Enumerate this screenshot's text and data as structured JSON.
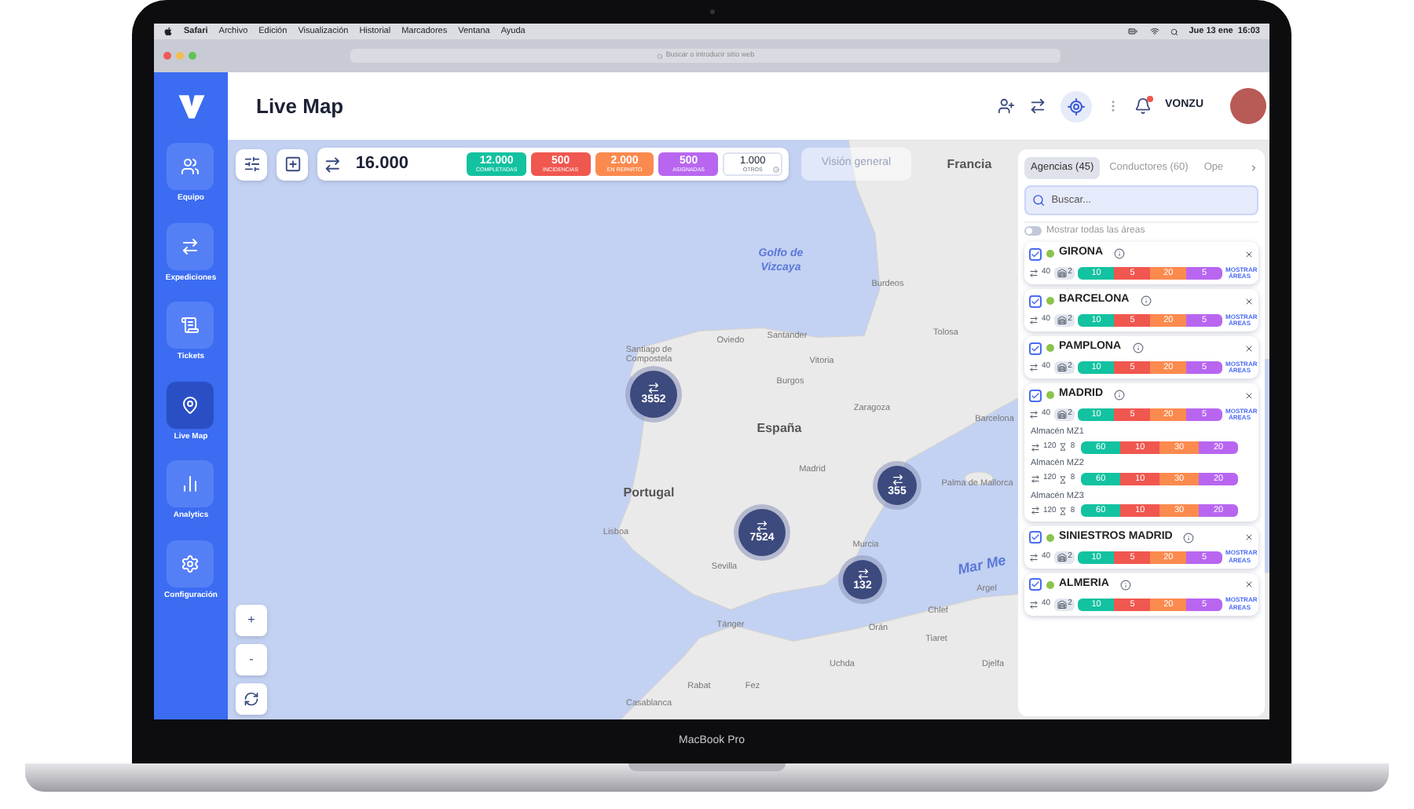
{
  "device_label": "MacBook Pro",
  "menubar": {
    "app": "Safari",
    "items": [
      "Archivo",
      "Edición",
      "Visualización",
      "Historial",
      "Marcadores",
      "Ventana",
      "Ayuda"
    ],
    "clock": "Jue 13 ene  16:03"
  },
  "browser": {
    "address_placeholder": "Buscar o introducir sitio web"
  },
  "sidebar": {
    "items": [
      {
        "label": "Equipo",
        "selected": false
      },
      {
        "label": "Expediciones",
        "selected": false
      },
      {
        "label": "Tickets",
        "selected": false
      },
      {
        "label": "Live Map",
        "selected": true
      },
      {
        "label": "Analytics",
        "selected": false
      },
      {
        "label": "Configuración",
        "selected": false
      }
    ]
  },
  "header": {
    "title": "Live Map",
    "user": "VONZU"
  },
  "toolbar": {
    "total": "16.000",
    "stats": [
      {
        "value": "12.000",
        "label": "COMPLETADAS",
        "color": "#13c2a0"
      },
      {
        "value": "500",
        "label": "INCIDENCIAS",
        "color": "#f0574f"
      },
      {
        "value": "2.000",
        "label": "EN REPARTO",
        "color": "#fb8a4e"
      },
      {
        "value": "500",
        "label": "ASIGNADAS",
        "color": "#b866f0"
      }
    ],
    "others": {
      "value": "1.000",
      "label": "OTROS"
    },
    "overview_button": "Visión general"
  },
  "map": {
    "labels": [
      {
        "text": "Francia",
        "kind": "country"
      },
      {
        "text": "Golfo de Vizcaya",
        "kind": "sea"
      },
      {
        "text": "Burdeos",
        "kind": "city"
      },
      {
        "text": "Tolosa",
        "kind": "city"
      },
      {
        "text": "Santiago de Compostela",
        "kind": "city"
      },
      {
        "text": "Oviedo",
        "kind": "city"
      },
      {
        "text": "Santander",
        "kind": "city"
      },
      {
        "text": "Vitoria",
        "kind": "city"
      },
      {
        "text": "Burgos",
        "kind": "city"
      },
      {
        "text": "Zaragoza",
        "kind": "city"
      },
      {
        "text": "Barcelona",
        "kind": "city"
      },
      {
        "text": "España",
        "kind": "country"
      },
      {
        "text": "Madrid",
        "kind": "city"
      },
      {
        "text": "Portugal",
        "kind": "country"
      },
      {
        "text": "Palma de Mallorca",
        "kind": "city"
      },
      {
        "text": "Lisboa",
        "kind": "city"
      },
      {
        "text": "Sevilla",
        "kind": "city"
      },
      {
        "text": "Murcia",
        "kind": "city"
      },
      {
        "text": "Mar Me",
        "kind": "sea"
      },
      {
        "text": "Argel",
        "kind": "city"
      },
      {
        "text": "Chlef",
        "kind": "city"
      },
      {
        "text": "Orán",
        "kind": "city"
      },
      {
        "text": "Tiaret",
        "kind": "city"
      },
      {
        "text": "Djelfa",
        "kind": "city"
      },
      {
        "text": "Uchda",
        "kind": "city"
      },
      {
        "text": "Tánger",
        "kind": "city"
      },
      {
        "text": "Rabat",
        "kind": "city"
      },
      {
        "text": "Fez",
        "kind": "city"
      },
      {
        "text": "Casablanca",
        "kind": "city"
      }
    ],
    "clusters": [
      {
        "count": "3552"
      },
      {
        "count": "7524"
      },
      {
        "count": "355"
      },
      {
        "count": "132"
      }
    ],
    "zoom_in": "+",
    "zoom_out": "-"
  },
  "panel": {
    "tabs": [
      {
        "label": "Agencias (45)",
        "selected": true
      },
      {
        "label": "Conductores (60)",
        "selected": false
      },
      {
        "label": "Ope",
        "selected": false
      }
    ],
    "search_placeholder": "Buscar...",
    "toggle": {
      "label": "Mostrar todas las áreas",
      "on": false
    },
    "agencies": [
      {
        "name": "GIRONA",
        "checked": true,
        "color": "#8bc34a",
        "routes": "40",
        "vehicles": "2",
        "segments": [
          "10",
          "5",
          "20",
          "5"
        ],
        "action": "MOSTRAR ÁREAS"
      },
      {
        "name": "BARCELONA",
        "checked": true,
        "color": "#8bc34a",
        "routes": "40",
        "vehicles": "2",
        "segments": [
          "10",
          "5",
          "20",
          "5"
        ],
        "action": "MOSTRAR ÁREAS"
      },
      {
        "name": "PAMPLONA",
        "checked": true,
        "color": "#8bc34a",
        "routes": "40",
        "vehicles": "2",
        "segments": [
          "10",
          "5",
          "20",
          "5"
        ],
        "action": "MOSTRAR ÁREAS"
      },
      {
        "name": "MADRID",
        "checked": true,
        "color": "#8bc34a",
        "routes": "40",
        "vehicles": "2",
        "segments": [
          "10",
          "5",
          "20",
          "5"
        ],
        "action": "MOSTRAR ÁREAS",
        "warehouses": [
          {
            "name": "Almacén MZ1",
            "routes": "120",
            "people": "8",
            "segments": [
              "60",
              "10",
              "30",
              "20"
            ]
          },
          {
            "name": "Almacén MZ2",
            "routes": "120",
            "people": "8",
            "segments": [
              "60",
              "10",
              "30",
              "20"
            ]
          },
          {
            "name": "Almacén MZ3",
            "routes": "120",
            "people": "8",
            "segments": [
              "60",
              "10",
              "30",
              "20"
            ]
          }
        ]
      },
      {
        "name": "SINIESTROS MADRID",
        "checked": true,
        "color": "#8bc34a",
        "routes": "40",
        "vehicles": "2",
        "segments": [
          "10",
          "5",
          "20",
          "5"
        ],
        "action": "MOSTRAR ÁREAS"
      },
      {
        "name": "ALMERIA",
        "checked": true,
        "color": "#8bc34a",
        "routes": "40",
        "vehicles": "2",
        "segments": [
          "10",
          "5",
          "20",
          "5"
        ],
        "action": "MOSTRAR ÁREAS"
      }
    ]
  }
}
